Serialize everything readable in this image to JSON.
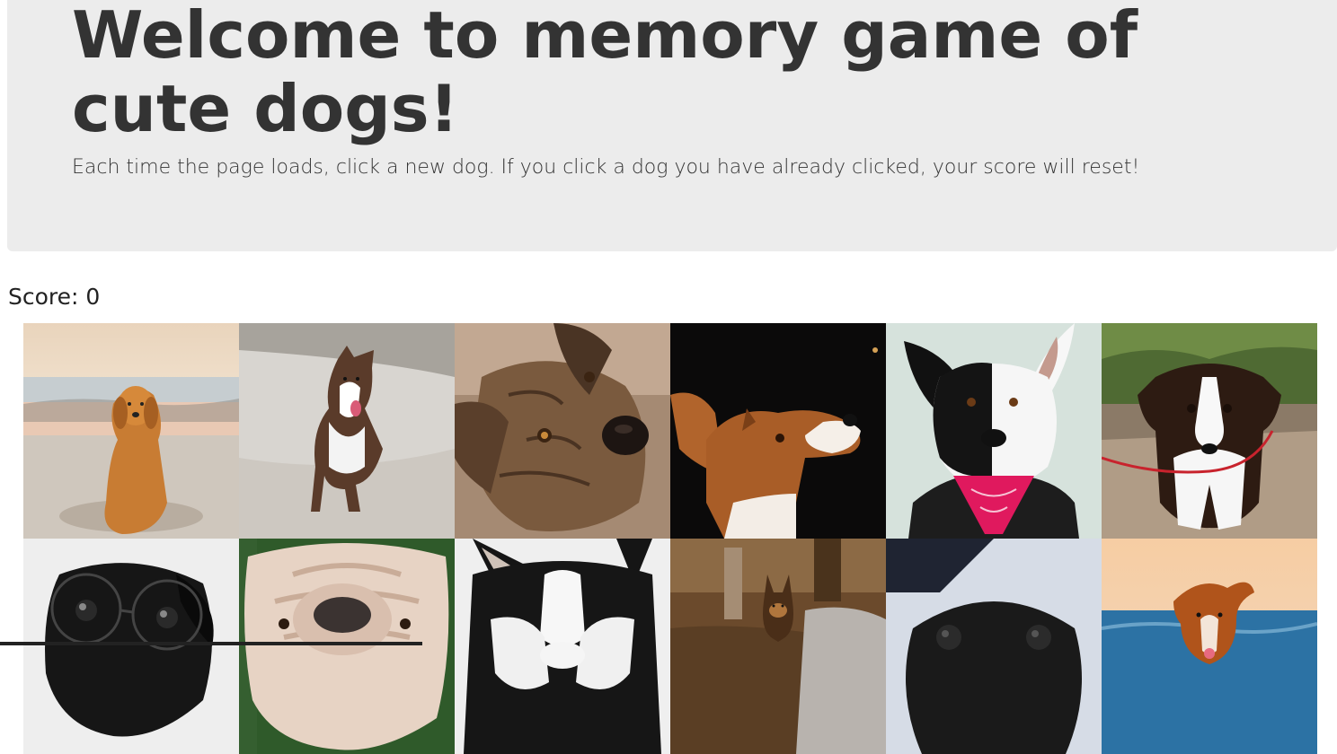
{
  "header": {
    "title": "Welcome to memory game of cute dogs!",
    "lead": "Each time the page loads, click a new dog. If you click a dog you have already clicked, your score will reset!"
  },
  "score": {
    "text": "Score: 0"
  },
  "colors": {
    "jumbotron_bg": "#ececec",
    "text": "#333333"
  },
  "cards": [
    {
      "name": "golden-retriever-beach"
    },
    {
      "name": "australian-shepherd-running"
    },
    {
      "name": "brindle-dog-closeup"
    },
    {
      "name": "brown-white-dog-dark-bg"
    },
    {
      "name": "border-collie-bandana"
    },
    {
      "name": "border-collie-puppy"
    },
    {
      "name": "pug-with-glasses"
    },
    {
      "name": "english-bulldog"
    },
    {
      "name": "husky"
    },
    {
      "name": "german-shepherd-path"
    },
    {
      "name": "black-pug"
    },
    {
      "name": "toller-beach"
    }
  ]
}
